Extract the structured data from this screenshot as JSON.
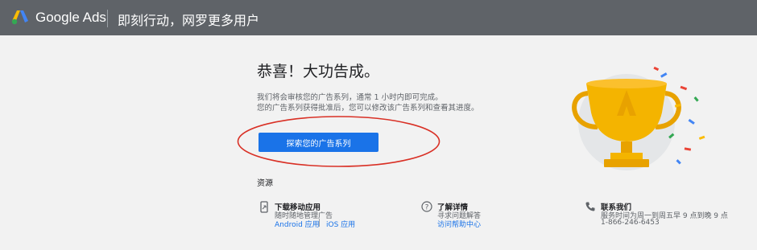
{
  "header": {
    "brand": "Google Ads",
    "slogan": "即刻行动，网罗更多用户"
  },
  "main": {
    "title": "恭喜！大功告成。",
    "desc_line1": "我们将会审核您的广告系列，通常 1 小时内即可完成。",
    "desc_line2": "您的广告系列获得批准后，您可以修改该广告系列和查看其进度。",
    "cta_label": "探索您的广告系列"
  },
  "resources": {
    "title": "资源",
    "app": {
      "title": "下载移动应用",
      "subtitle": "随时随地管理广告",
      "android": "Android 应用",
      "ios": "iOS 应用"
    },
    "learn": {
      "title": "了解详情",
      "subtitle": "寻求问题解答",
      "link": "访问帮助中心"
    },
    "contact": {
      "title": "联系我们",
      "hours": "服务时间为周一到周五早 9 点到晚 9 点",
      "phone": "1-866-246-6453"
    }
  },
  "colors": {
    "header_bg": "#5f6368",
    "accent": "#1a73e8",
    "annotation": "#d93025",
    "trophy": "#f4b400"
  }
}
